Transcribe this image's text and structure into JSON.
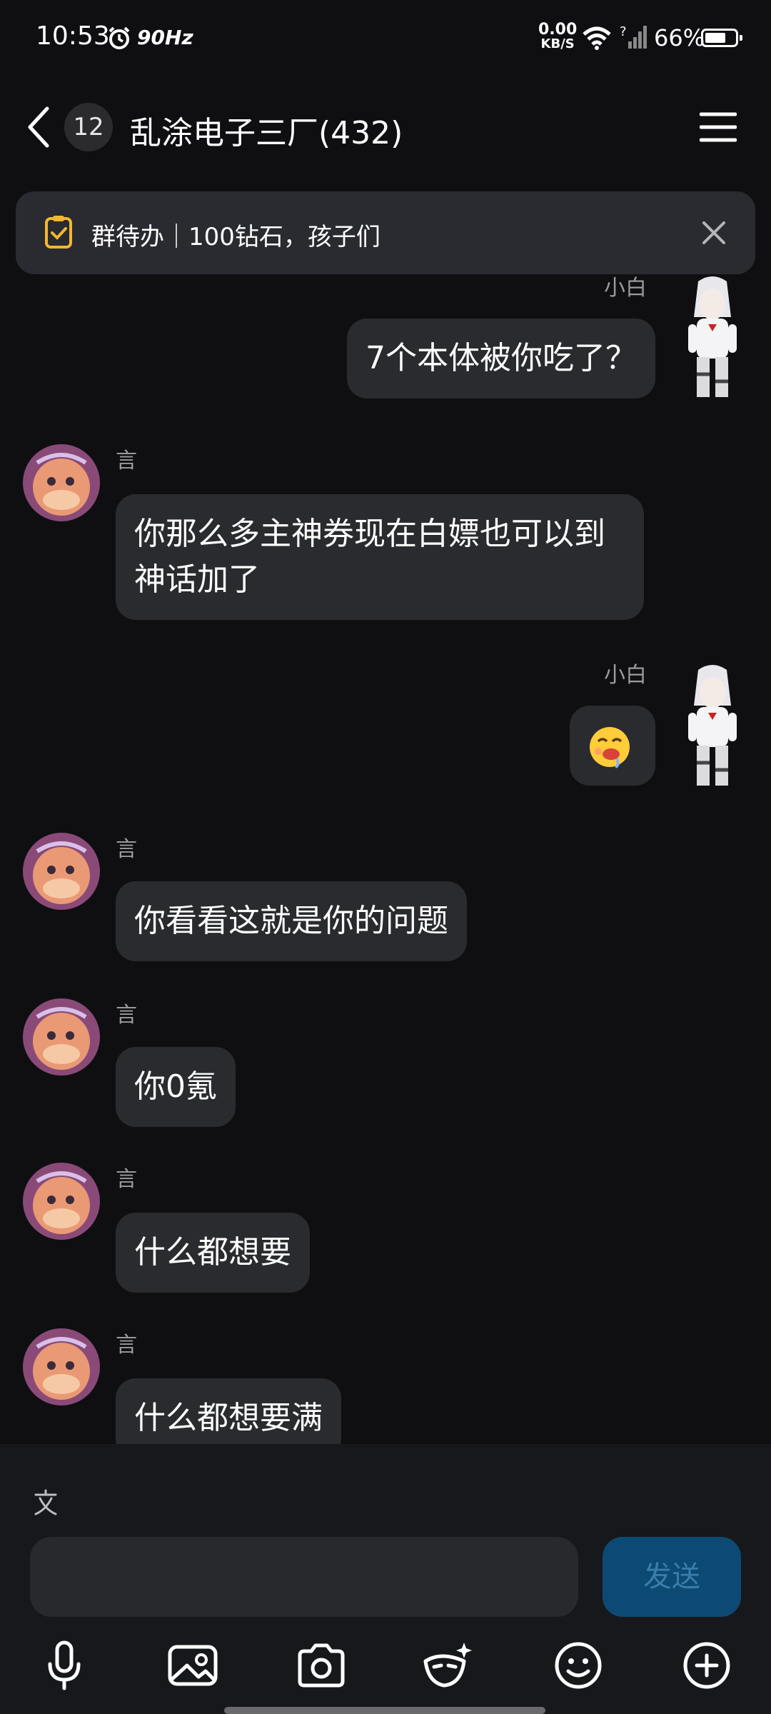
{
  "status_bar": {
    "time": "10:53",
    "refresh_rate": "90Hz",
    "net_speed_value": "0.00",
    "net_speed_unit": "KB/S",
    "signal_note": "?",
    "battery": "66%"
  },
  "header": {
    "unread_count": "12",
    "title": "乱涂电子三厂(432)"
  },
  "todo_banner": {
    "text": "群待办｜100钻石，孩子们"
  },
  "messages": [
    {
      "sender": "小白",
      "side": "right",
      "text": "7个本体被你吃了？"
    },
    {
      "sender": "言",
      "side": "left",
      "text": "你那么多主神券现在白嫖也可以到神话加了"
    },
    {
      "sender": "小白",
      "side": "right",
      "text": "🤤",
      "emoji": "drooling-face"
    },
    {
      "sender": "言",
      "side": "left",
      "text": "你看看这就是你的问题"
    },
    {
      "sender": "言",
      "side": "left",
      "text": "你0氪"
    },
    {
      "sender": "言",
      "side": "left",
      "text": "什么都想要"
    },
    {
      "sender": "言",
      "side": "left",
      "text": "什么都想要满"
    }
  ],
  "composer": {
    "input_value": "",
    "send_label": "发送"
  },
  "toolbar_icons": [
    "microphone-icon",
    "image-icon",
    "camera-icon",
    "sticker-icon",
    "emoji-icon",
    "plus-icon"
  ],
  "colors": {
    "background": "#0f0f11",
    "bubble": "#2a2b2f",
    "send_button": "#0c4a73",
    "todo_icon": "#f4b731"
  }
}
